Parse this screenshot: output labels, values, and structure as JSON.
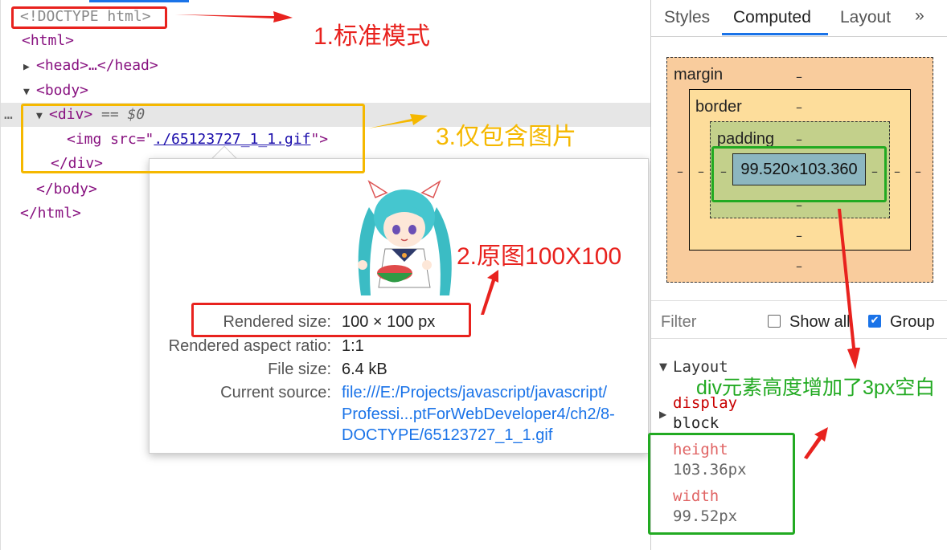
{
  "elements": {
    "doctype": "<!DOCTYPE html>",
    "html_open": "<html>",
    "head_collapsed": "<head>…</head>",
    "body_open": "<body>",
    "div_open": "<div>",
    "selected_marker": "== $0",
    "ellipsis": "…",
    "img_tag_start": "<img src=\"",
    "img_src": "./65123727_1_1.gif",
    "img_tag_end": "\">",
    "div_close": "</div>",
    "body_close": "</body>",
    "html_close": "</html>"
  },
  "tooltip": {
    "rows": [
      {
        "label": "Rendered size:",
        "value": "100 × 100 px"
      },
      {
        "label": "Rendered aspect ratio:",
        "value": "1:1"
      },
      {
        "label": "File size:",
        "value": "6.4 kB"
      },
      {
        "label": "Current source:",
        "value": "file:///E:/Projects/javascript/javascript/"
      }
    ],
    "source_line2": "Professi...ptForWebDeveloper4/ch2/8-",
    "source_line3": "DOCTYPE/65123727_1_1.gif"
  },
  "annotations": {
    "note1": "1.标准模式",
    "note2": "2.原图100X100",
    "note3": "3.仅包含图片",
    "note4": "div元素高度增加了3px空白",
    "colors": {
      "red": "#e8221e",
      "orange": "#f5b800",
      "green": "#22aa22"
    }
  },
  "styles_panel": {
    "tabs": [
      "Styles",
      "Computed",
      "Layout"
    ],
    "active_tab": "Computed",
    "more_icon": "»",
    "box_model": {
      "margin_label": "margin",
      "border_label": "border",
      "padding_label": "padding",
      "dash": "–",
      "content_size": "99.520×103.360"
    },
    "filter_placeholder": "Filter",
    "show_all_label": "Show all",
    "show_all_checked": false,
    "group_label": "Group",
    "group_checked": true,
    "section_title": "Layout",
    "properties": [
      {
        "name": "display",
        "value": "block"
      },
      {
        "name": "height",
        "value": "103.36px"
      },
      {
        "name": "width",
        "value": "99.52px"
      }
    ]
  }
}
